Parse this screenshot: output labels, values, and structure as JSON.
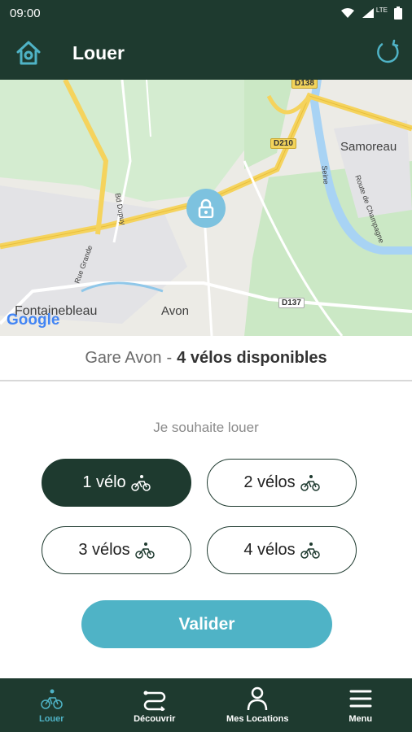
{
  "status_bar": {
    "time": "09:00",
    "network": "LTE"
  },
  "app_bar": {
    "title": "Louer"
  },
  "map": {
    "places": {
      "samoreau": "Samoreau",
      "fontainebleau": "Fontainebleau",
      "avon": "Avon"
    },
    "roads": {
      "d138": "D138",
      "d210": "D210",
      "d137": "D137"
    },
    "streets": {
      "rue_grande": "Rue Grande",
      "bd_dupuy": "Bd Dupuy",
      "seine": "Seine",
      "route_champagne": "Route de Champagne"
    },
    "attribution": "Google"
  },
  "station": {
    "name": "Gare Avon",
    "separator": "-",
    "availability": "4 vélos disponibles"
  },
  "prompt": "Je souhaite louer",
  "choices": [
    {
      "label": "1 vélo",
      "selected": true
    },
    {
      "label": "2 vélos",
      "selected": false
    },
    {
      "label": "3 vélos",
      "selected": false
    },
    {
      "label": "4 vélos",
      "selected": false
    }
  ],
  "validate_label": "Valider",
  "nav": [
    {
      "label": "Louer",
      "active": true
    },
    {
      "label": "Découvrir",
      "active": false
    },
    {
      "label": "Mes Locations",
      "active": false
    },
    {
      "label": "Menu",
      "active": false
    }
  ],
  "colors": {
    "primary": "#1e3a2f",
    "accent": "#4fb3c6",
    "marker": "#7dc2df"
  }
}
